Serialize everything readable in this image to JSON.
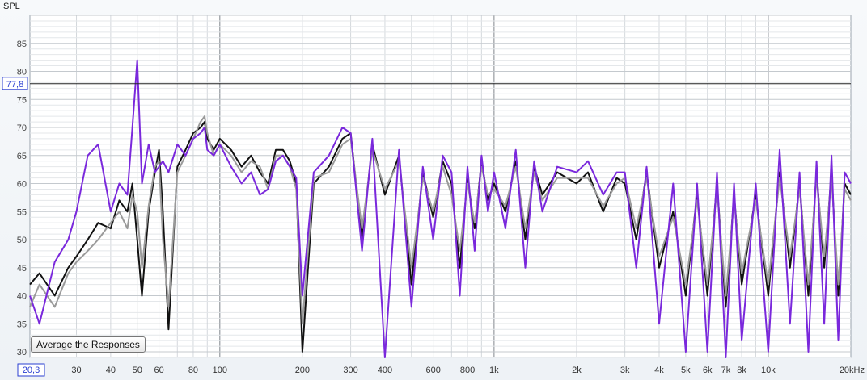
{
  "chart_data": {
    "type": "line",
    "ylabel": "SPL",
    "xaxis": {
      "scale": "log",
      "range": [
        20.3,
        20000
      ],
      "tick_labels": [
        {
          "value": 30,
          "label": "30"
        },
        {
          "value": 40,
          "label": "40"
        },
        {
          "value": 50,
          "label": "50"
        },
        {
          "value": 60,
          "label": "60"
        },
        {
          "value": 80,
          "label": "80"
        },
        {
          "value": 100,
          "label": "100"
        },
        {
          "value": 200,
          "label": "200"
        },
        {
          "value": 300,
          "label": "300"
        },
        {
          "value": 400,
          "label": "400"
        },
        {
          "value": 600,
          "label": "600"
        },
        {
          "value": 800,
          "label": "800"
        },
        {
          "value": 1000,
          "label": "1k"
        },
        {
          "value": 2000,
          "label": "2k"
        },
        {
          "value": 3000,
          "label": "3k"
        },
        {
          "value": 4000,
          "label": "4k"
        },
        {
          "value": 5000,
          "label": "5k"
        },
        {
          "value": 6000,
          "label": "6k"
        },
        {
          "value": 7000,
          "label": "7k"
        },
        {
          "value": 8000,
          "label": "8k"
        },
        {
          "value": 10000,
          "label": "10k"
        },
        {
          "value": 20000,
          "label": "20kHz"
        }
      ],
      "start_readout": "20,3"
    },
    "yaxis": {
      "range": [
        29,
        90
      ],
      "ticks": [
        30,
        35,
        40,
        45,
        50,
        55,
        60,
        65,
        70,
        75,
        80,
        85
      ],
      "cursor_readout": "77,8",
      "cursor_value": 77.8
    },
    "grid": true,
    "colors": {
      "black": "#111111",
      "gray": "#9a9a9a",
      "purple": "#7a28dc",
      "readout": "#2a3fd1"
    },
    "series": [
      {
        "color": "#111111",
        "x": [
          20.3,
          22,
          25,
          28,
          30,
          33,
          36,
          40,
          43,
          46,
          48,
          50,
          52,
          55,
          58,
          60,
          62,
          65,
          70,
          75,
          80,
          85,
          88,
          90,
          95,
          100,
          110,
          120,
          130,
          140,
          150,
          160,
          170,
          180,
          190,
          200,
          220,
          250,
          280,
          300,
          330,
          360,
          400,
          450,
          500,
          550,
          600,
          650,
          700,
          750,
          800,
          850,
          900,
          950,
          1000,
          1100,
          1200,
          1300,
          1400,
          1500,
          1700,
          2000,
          2200,
          2500,
          2800,
          3000,
          3300,
          3600,
          4000,
          4500,
          5000,
          5500,
          6000,
          6500,
          7000,
          7500,
          8000,
          9000,
          10000,
          11000,
          12000,
          13000,
          14000,
          15000,
          16000,
          17000,
          18000,
          19000,
          20000
        ],
        "y": [
          42,
          44,
          40,
          45,
          47,
          50,
          53,
          52,
          57,
          55,
          60,
          50,
          40,
          55,
          62,
          66,
          55,
          34,
          63,
          66,
          69,
          70,
          71,
          68,
          66,
          68,
          66,
          63,
          65,
          62,
          60,
          66,
          66,
          64,
          60,
          30,
          60,
          63,
          68,
          69,
          50,
          67,
          58,
          65,
          42,
          62,
          54,
          64,
          60,
          45,
          61,
          52,
          64,
          57,
          60,
          55,
          64,
          50,
          63,
          58,
          62,
          60,
          62,
          55,
          61,
          60,
          50,
          62,
          45,
          55,
          40,
          58,
          40,
          60,
          38,
          58,
          42,
          58,
          40,
          62,
          45,
          60,
          40,
          62,
          45,
          62,
          40,
          60,
          58
        ]
      },
      {
        "color": "#9a9a9a",
        "x": [
          20.3,
          22,
          25,
          28,
          30,
          33,
          36,
          40,
          43,
          46,
          48,
          50,
          52,
          55,
          58,
          60,
          62,
          65,
          70,
          75,
          80,
          85,
          88,
          90,
          95,
          100,
          110,
          120,
          130,
          140,
          150,
          160,
          170,
          180,
          190,
          200,
          220,
          250,
          280,
          300,
          330,
          360,
          400,
          450,
          500,
          550,
          600,
          650,
          700,
          750,
          800,
          850,
          900,
          950,
          1000,
          1100,
          1200,
          1300,
          1400,
          1500,
          1700,
          2000,
          2200,
          2500,
          2800,
          3000,
          3300,
          3600,
          4000,
          4500,
          5000,
          5500,
          6000,
          6500,
          7000,
          7500,
          8000,
          9000,
          10000,
          11000,
          12000,
          13000,
          14000,
          15000,
          16000,
          17000,
          18000,
          19000,
          20000
        ],
        "y": [
          38,
          42,
          38,
          44,
          46,
          48,
          50,
          53,
          55,
          52,
          58,
          55,
          45,
          56,
          63,
          64,
          50,
          38,
          62,
          65,
          68,
          71,
          72,
          69,
          65,
          67,
          65,
          62,
          64,
          63,
          59,
          65,
          65,
          63,
          59,
          35,
          61,
          62,
          67,
          68,
          52,
          66,
          59,
          64,
          45,
          61,
          55,
          63,
          58,
          48,
          60,
          53,
          63,
          58,
          59,
          56,
          63,
          52,
          62,
          57,
          61,
          61,
          61,
          56,
          60,
          61,
          52,
          61,
          47,
          54,
          42,
          57,
          42,
          59,
          40,
          57,
          44,
          57,
          42,
          61,
          47,
          59,
          42,
          61,
          47,
          61,
          42,
          59,
          57
        ]
      },
      {
        "color": "#7a28dc",
        "x": [
          20.3,
          22,
          25,
          28,
          30,
          33,
          36,
          40,
          43,
          46,
          48,
          50,
          52,
          55,
          58,
          60,
          62,
          65,
          70,
          75,
          80,
          85,
          88,
          90,
          95,
          100,
          110,
          120,
          130,
          140,
          150,
          160,
          170,
          180,
          190,
          200,
          220,
          250,
          280,
          300,
          330,
          360,
          400,
          450,
          500,
          550,
          600,
          650,
          700,
          750,
          800,
          850,
          900,
          950,
          1000,
          1100,
          1200,
          1300,
          1400,
          1500,
          1700,
          2000,
          2200,
          2500,
          2800,
          3000,
          3300,
          3600,
          4000,
          4500,
          5000,
          5500,
          6000,
          6500,
          7000,
          7500,
          8000,
          9000,
          10000,
          11000,
          12000,
          13000,
          14000,
          15000,
          16000,
          17000,
          18000,
          19000,
          20000
        ],
        "y": [
          40,
          35,
          46,
          50,
          55,
          65,
          67,
          55,
          60,
          58,
          70,
          82,
          60,
          67,
          62,
          63,
          64,
          62,
          67,
          65,
          68,
          69,
          70,
          66,
          65,
          67,
          63,
          60,
          62,
          58,
          59,
          64,
          65,
          63,
          61,
          40,
          62,
          65,
          70,
          69,
          48,
          68,
          28,
          66,
          38,
          63,
          50,
          65,
          62,
          40,
          63,
          48,
          65,
          55,
          62,
          52,
          66,
          45,
          64,
          55,
          63,
          62,
          64,
          58,
          62,
          62,
          45,
          63,
          35,
          60,
          30,
          60,
          30,
          62,
          28,
          60,
          32,
          60,
          30,
          66,
          35,
          62,
          30,
          64,
          35,
          65,
          32,
          62,
          60
        ]
      }
    ]
  },
  "tooltip": {
    "text": "Average the Responses"
  }
}
